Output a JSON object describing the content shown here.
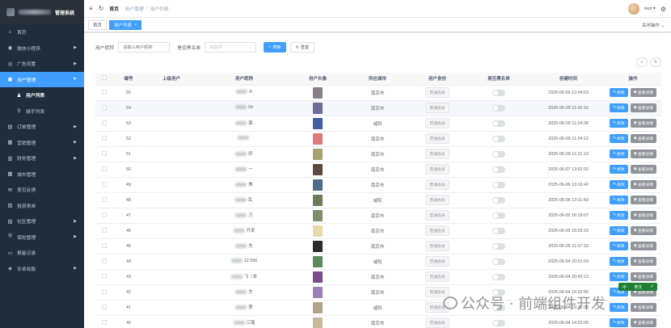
{
  "sidebar": {
    "title": "管理系统",
    "items": [
      {
        "label": "首页",
        "icon": "home-icon",
        "glyph": "⌂",
        "arrow": false,
        "state": ""
      },
      {
        "label": "微信小程序",
        "icon": "wechat-icon",
        "glyph": "◉",
        "arrow": true,
        "state": ""
      },
      {
        "label": "广告设置",
        "icon": "ad-icon",
        "glyph": "◎",
        "arrow": true,
        "state": ""
      },
      {
        "label": "用户管理",
        "icon": "user-icon",
        "glyph": "▣",
        "arrow": true,
        "state": "active",
        "arrow_glyph": "▼"
      },
      {
        "label": "用户列表",
        "icon": "person-icon",
        "glyph": "♟",
        "arrow": false,
        "state": "sub cur"
      },
      {
        "label": "骑手列表",
        "icon": "bike-icon",
        "glyph": "⚲",
        "arrow": false,
        "state": "sub"
      },
      {
        "label": "订单管理",
        "icon": "order-icon",
        "glyph": "▤",
        "arrow": true,
        "state": ""
      },
      {
        "label": "营销管理",
        "icon": "marketing-icon",
        "glyph": "▦",
        "arrow": true,
        "state": ""
      },
      {
        "label": "财务管理",
        "icon": "finance-icon",
        "glyph": "▥",
        "arrow": true,
        "state": ""
      },
      {
        "label": "城市管理",
        "icon": "city-icon",
        "glyph": "▩",
        "arrow": false,
        "state": ""
      },
      {
        "label": "意见反馈",
        "icon": "feedback-icon",
        "glyph": "✉",
        "arrow": false,
        "state": ""
      },
      {
        "label": "投资表单",
        "icon": "form-icon",
        "glyph": "▨",
        "arrow": false,
        "state": ""
      },
      {
        "label": "社区管理",
        "icon": "community-icon",
        "glyph": "▧",
        "arrow": true,
        "state": ""
      },
      {
        "label": "保险管理",
        "icon": "insurance-icon",
        "glyph": "⛨",
        "arrow": true,
        "state": ""
      },
      {
        "label": "报备记录",
        "icon": "report-icon",
        "glyph": "▭",
        "arrow": false,
        "state": ""
      },
      {
        "label": "安卓收款",
        "icon": "android-icon",
        "glyph": "◈",
        "arrow": true,
        "state": ""
      }
    ]
  },
  "navbar": {
    "breadcrumb": [
      "首页",
      "用户管理",
      "用户列表"
    ],
    "username": "test"
  },
  "tags": {
    "home": "首页",
    "current": "用户列表",
    "close_ops": "关闭操作"
  },
  "search": {
    "nickname_label": "用户昵称",
    "nickname_placeholder": "请输入用户昵称",
    "blacklist_label": "是否黑名单",
    "blacklist_placeholder": "请选择",
    "search_btn": "搜索",
    "reset_btn": "重置"
  },
  "table": {
    "headers": [
      "编号",
      "上级用户",
      "用户昵称",
      "用户头像",
      "所在城市",
      "用户身份",
      "是否黑名单",
      "创建时间",
      "操作"
    ],
    "edit_label": "修改",
    "view_label": "查看详情",
    "rows": [
      {
        "id": "55",
        "nick": "A",
        "city": "南京市",
        "role": "普通会员",
        "time": "2025-06-09 12:04:53",
        "thumb": "#8a7f86"
      },
      {
        "id": "54",
        "nick": "Sk",
        "city": "南京市",
        "role": "普通会员",
        "time": "2025-06-09 11:42:16",
        "thumb": "#6e6d9a"
      },
      {
        "id": "53",
        "nick": "宸",
        "city": "咸阳",
        "role": "普通会员",
        "time": "2025-06-09 11:24:36",
        "thumb": "#3f5fa0"
      },
      {
        "id": "52",
        "nick": "",
        "city": "南京市",
        "role": "普通会员",
        "time": "2025-06-09 11:24:12",
        "thumb": "#e07a7a"
      },
      {
        "id": "51",
        "nick": "好",
        "city": "南京市",
        "role": "普通会员",
        "time": "2025-06-09 11:21:13",
        "thumb": "#a8a36e"
      },
      {
        "id": "50",
        "nick": "一",
        "city": "南京市",
        "role": "普通会员",
        "time": "2025-06-07 13:52:32",
        "thumb": "#5b4a3e"
      },
      {
        "id": "49",
        "nick": "美",
        "city": "南京市",
        "role": "普通会员",
        "time": "2025-06-06 13:16:42",
        "thumb": "#4e6c8c"
      },
      {
        "id": "48",
        "nick": "乱",
        "city": "咸阳",
        "role": "普通会员",
        "time": "2025-06-06 13:11:43",
        "thumb": "#6d7c5a"
      },
      {
        "id": "47",
        "nick": "刀",
        "city": "南京市",
        "role": "普通会员",
        "time": "2025-06-05 16:19:07",
        "thumb": "#7a8f6a"
      },
      {
        "id": "46",
        "nick": "开发",
        "city": "南京市",
        "role": "普通会员",
        "time": "2025-06-05 15:03:10",
        "thumb": "#e9d9a8"
      },
      {
        "id": "45",
        "nick": "杰",
        "city": "南京市",
        "role": "普通会员",
        "time": "2025-06-05 11:07:33",
        "thumb": "#2e2a2a"
      },
      {
        "id": "44",
        "nick": "12 556",
        "city": "咸阳",
        "role": "普通会员",
        "time": "2025-06-04 20:51:03",
        "thumb": "#5a8a5e"
      },
      {
        "id": "43",
        "nick": "飞（本",
        "city": "南京市",
        "role": "普通会员",
        "time": "2025-06-04 20:42:12",
        "thumb": "#7a4a8c"
      },
      {
        "id": "42",
        "nick": "杰",
        "city": "南京市",
        "role": "普通会员",
        "time": "2025-06-04 16:32:55",
        "thumb": "#9a7fb8"
      },
      {
        "id": "41",
        "nick": "莲",
        "city": "咸阳",
        "role": "普通会员",
        "time": "2025-06-04 15:12:30",
        "thumb": "#b0a78a"
      },
      {
        "id": "40",
        "nick": "江璐",
        "city": "南京市",
        "role": "普通会员",
        "time": "2025-06-04 14:22:05",
        "thumb": "#c9b79a"
      }
    ]
  },
  "ime": {
    "left": "中",
    "mid": "英文",
    "right": "↗"
  },
  "watermark": "公众号 · 前端组件开发"
}
